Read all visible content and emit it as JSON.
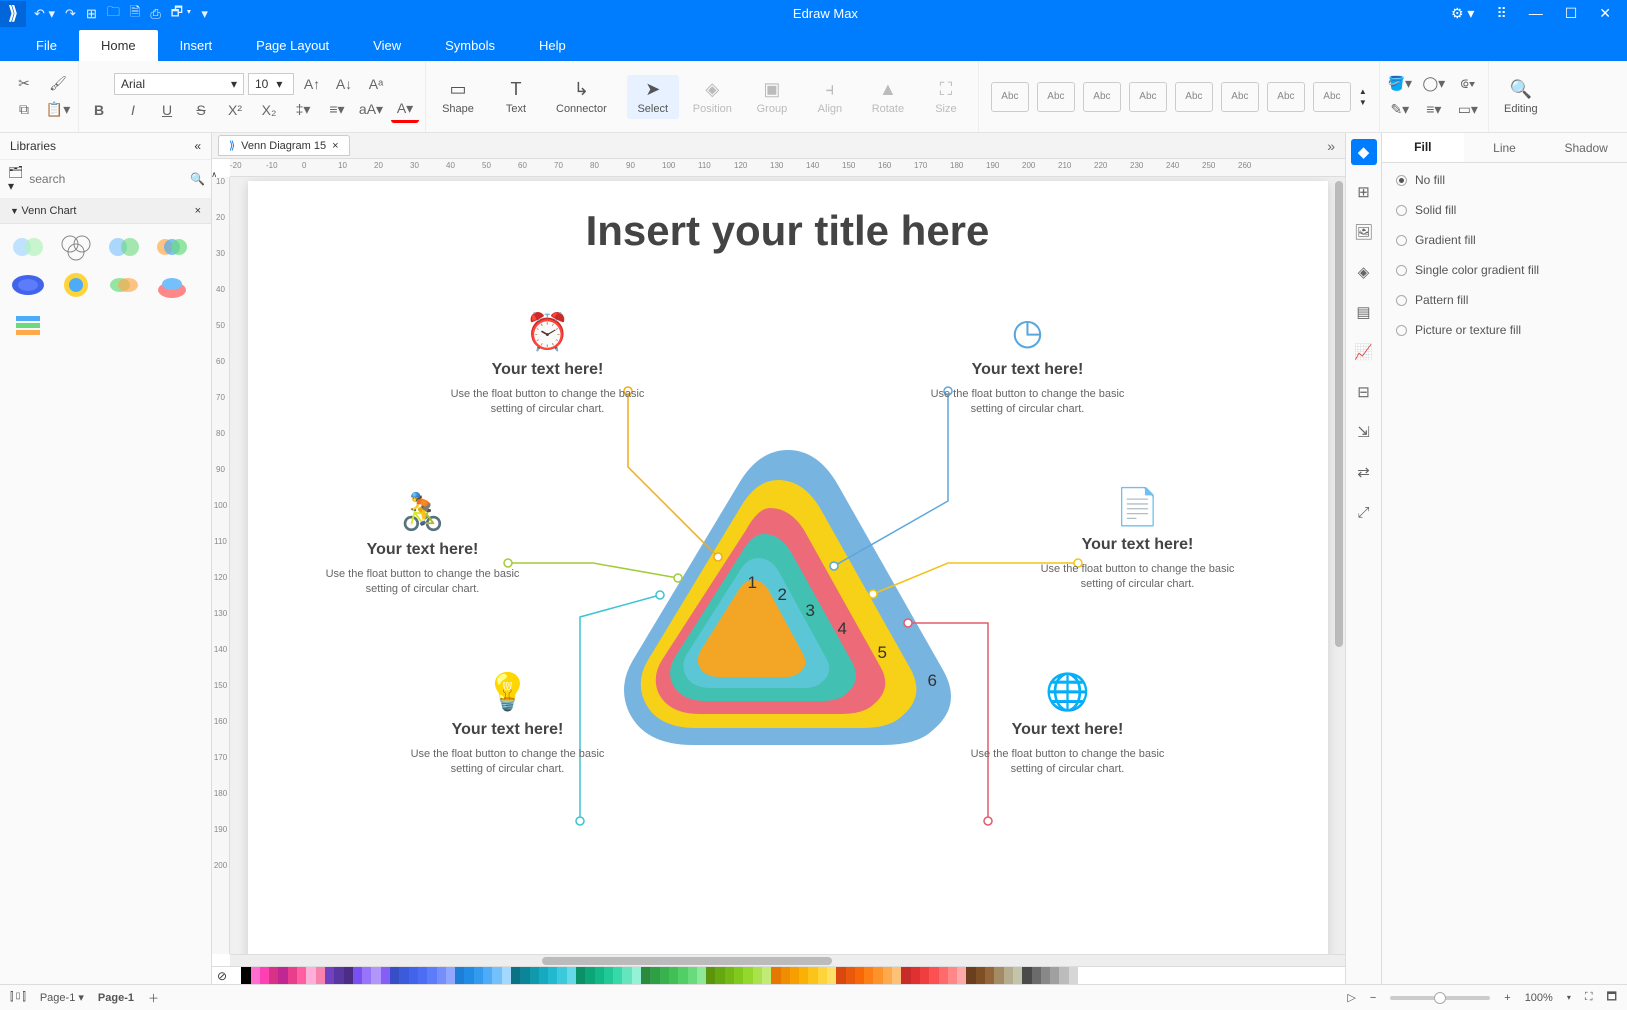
{
  "app": {
    "title": "Edraw Max"
  },
  "menu": {
    "tabs": [
      "File",
      "Home",
      "Insert",
      "Page Layout",
      "View",
      "Symbols",
      "Help"
    ],
    "active": 1
  },
  "ribbon": {
    "font_family": "Arial",
    "font_size": "10",
    "groups": {
      "shape": "Shape",
      "text": "Text",
      "connector": "Connector",
      "select": "Select",
      "position": "Position",
      "group": "Group",
      "align": "Align",
      "rotate": "Rotate",
      "size": "Size",
      "editing": "Editing"
    },
    "style_thumbs": [
      "Abc",
      "Abc",
      "Abc",
      "Abc",
      "Abc",
      "Abc",
      "Abc",
      "Abc"
    ]
  },
  "libraries": {
    "header": "Libraries",
    "search_placeholder": "search",
    "category": "Venn Chart"
  },
  "doc_tab": "Venn Diagram 15",
  "canvas": {
    "title": "Insert your title here",
    "callouts": [
      {
        "heading": "Your text here!",
        "body": "Use the float button to change the basic setting of circular chart.",
        "color": "#f3aa18"
      },
      {
        "heading": "Your text here!",
        "body": "Use the float button to change the basic setting of circular chart.",
        "color": "#a2cc38"
      },
      {
        "heading": "Your text here!",
        "body": "Use the float button to change the basic setting of circular chart.",
        "color": "#3dc4d0"
      },
      {
        "heading": "Your text here!",
        "body": "Use the float button to change the basic setting of circular chart.",
        "color": "#5aa7de"
      },
      {
        "heading": "Your text here!",
        "body": "Use the float button to change the basic setting of circular chart.",
        "color": "#f2c318"
      },
      {
        "heading": "Your text here!",
        "body": "Use the float button to change the basic setting of circular chart.",
        "color": "#e25c6b"
      }
    ],
    "layers": [
      "1",
      "2",
      "3",
      "4",
      "5",
      "6"
    ]
  },
  "right_panel": {
    "tabs": [
      "Fill",
      "Line",
      "Shadow"
    ],
    "active": 0,
    "options": [
      "No fill",
      "Solid fill",
      "Gradient fill",
      "Single color gradient fill",
      "Pattern fill",
      "Picture or texture fill"
    ]
  },
  "status": {
    "page_select": "Page-1",
    "page_label": "Page-1",
    "zoom": "100%"
  },
  "colors": [
    "#ffffff",
    "#000000",
    "#ff6fcf",
    "#ff40b4",
    "#d63384",
    "#c02694",
    "#e83e8c",
    "#ff5fa2",
    "#ffb0d9",
    "#f783ac",
    "#6f42c1",
    "#5936a2",
    "#4b2e83",
    "#7950f2",
    "#9775fa",
    "#b197fc",
    "#845ef7",
    "#364fc7",
    "#3b5bdb",
    "#4263eb",
    "#4c6ef5",
    "#5c7cfa",
    "#748ffc",
    "#91a7ff",
    "#1c7ed6",
    "#228be6",
    "#339af0",
    "#4dabf7",
    "#74c0fc",
    "#a5d8ff",
    "#0b7285",
    "#0c8599",
    "#1098ad",
    "#15aabf",
    "#22b8cf",
    "#3bc9db",
    "#66d9e8",
    "#099268",
    "#0ca678",
    "#12b886",
    "#20c997",
    "#38d9a9",
    "#63e6be",
    "#96f2d7",
    "#2b8a3e",
    "#2f9e44",
    "#37b24d",
    "#40c057",
    "#51cf66",
    "#69db7c",
    "#8ce99a",
    "#5c940d",
    "#66a80f",
    "#74b816",
    "#82c91e",
    "#94d82d",
    "#a9e34b",
    "#c0eb75",
    "#e67700",
    "#f08c00",
    "#f59f00",
    "#fab005",
    "#fcc419",
    "#ffd43b",
    "#ffe066",
    "#d9480f",
    "#e8590c",
    "#f76707",
    "#fd7e14",
    "#ff922b",
    "#ffa94d",
    "#ffc078",
    "#c92a2a",
    "#e03131",
    "#f03e3e",
    "#fa5252",
    "#ff6b6b",
    "#ff8787",
    "#ffa8a8",
    "#6b3f1d",
    "#7f4f24",
    "#936639",
    "#a68a64",
    "#b6ad90",
    "#c2c5aa",
    "#4a4a4a",
    "#6b6b6b",
    "#888888",
    "#a0a0a0",
    "#bcbcbc",
    "#d6d6d6"
  ]
}
